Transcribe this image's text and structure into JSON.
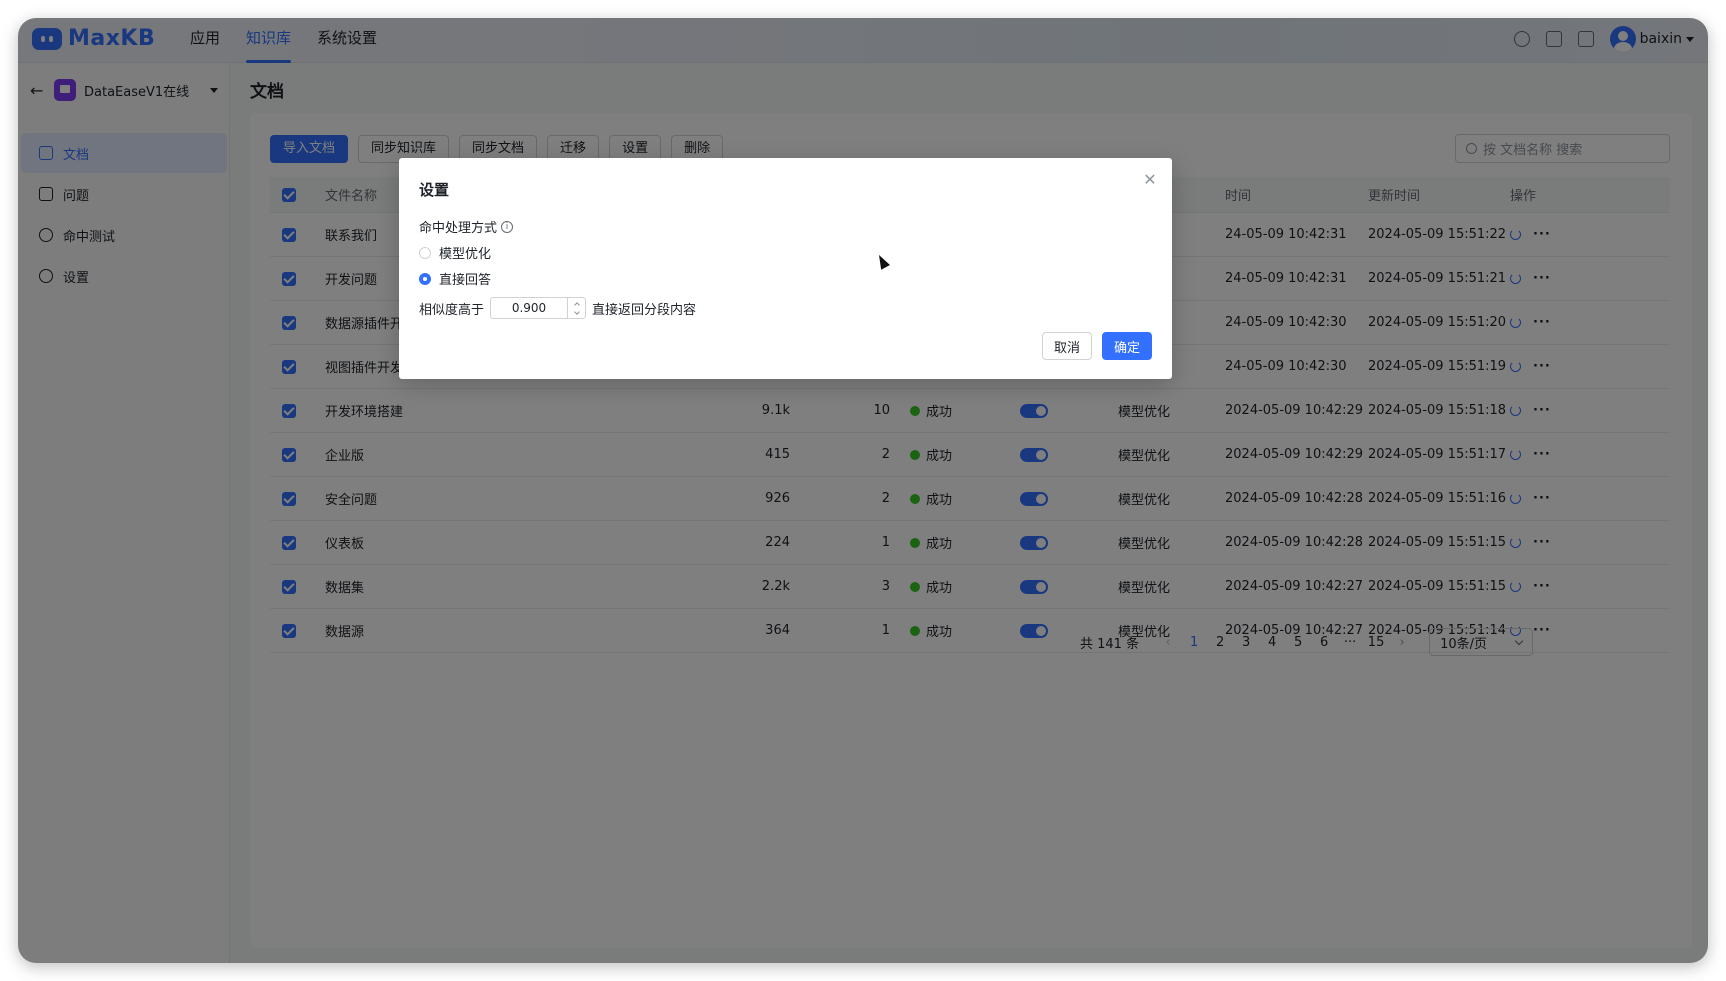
{
  "app": {
    "logo_text": "MaxKB"
  },
  "nav": {
    "items": [
      "应用",
      "知识库",
      "系统设置"
    ],
    "active": "知识库"
  },
  "user": {
    "name": "baixin"
  },
  "sidebar": {
    "dataset_name": "DataEaseV1在线",
    "items": [
      {
        "label": "文档",
        "icon": "document-icon",
        "active": true
      },
      {
        "label": "问题",
        "icon": "question-icon",
        "active": false
      },
      {
        "label": "命中测试",
        "icon": "target-icon",
        "active": false
      },
      {
        "label": "设置",
        "icon": "gear-icon",
        "active": false
      }
    ]
  },
  "page": {
    "title": "文档"
  },
  "toolbar": {
    "import_label": "导入文档",
    "sync_kb_label": "同步知识库",
    "sync_doc_label": "同步文档",
    "migrate_label": "迁移",
    "settings_label": "设置",
    "delete_label": "删除",
    "search_placeholder": "按 文档名称 搜索"
  },
  "table": {
    "headers": {
      "name": "文件名称",
      "created_partial": "时间",
      "updated": "更新时间",
      "ops": "操作"
    },
    "rows": [
      {
        "name": "联系我们",
        "chars": "",
        "segments": "",
        "status": "",
        "mode": "",
        "created": "24-05-09 10:42:31",
        "updated": "2024-05-09 15:51:22"
      },
      {
        "name": "开发问题",
        "chars": "",
        "segments": "",
        "status": "",
        "mode": "",
        "created": "24-05-09 10:42:31",
        "updated": "2024-05-09 15:51:21"
      },
      {
        "name": "数据源插件开发示例",
        "chars": "",
        "segments": "",
        "status": "",
        "mode": "",
        "created": "24-05-09 10:42:30",
        "updated": "2024-05-09 15:51:20"
      },
      {
        "name": "视图插件开发示例",
        "chars": "",
        "segments": "",
        "status": "",
        "mode": "",
        "created": "24-05-09 10:42:30",
        "updated": "2024-05-09 15:51:19"
      },
      {
        "name": "开发环境搭建",
        "chars": "9.1k",
        "segments": "10",
        "status": "成功",
        "mode": "模型优化",
        "created": "2024-05-09 10:42:29",
        "updated": "2024-05-09 15:51:18"
      },
      {
        "name": "企业版",
        "chars": "415",
        "segments": "2",
        "status": "成功",
        "mode": "模型优化",
        "created": "2024-05-09 10:42:29",
        "updated": "2024-05-09 15:51:17"
      },
      {
        "name": "安全问题",
        "chars": "926",
        "segments": "2",
        "status": "成功",
        "mode": "模型优化",
        "created": "2024-05-09 10:42:28",
        "updated": "2024-05-09 15:51:16"
      },
      {
        "name": "仪表板",
        "chars": "224",
        "segments": "1",
        "status": "成功",
        "mode": "模型优化",
        "created": "2024-05-09 10:42:28",
        "updated": "2024-05-09 15:51:15"
      },
      {
        "name": "数据集",
        "chars": "2.2k",
        "segments": "3",
        "status": "成功",
        "mode": "模型优化",
        "created": "2024-05-09 10:42:27",
        "updated": "2024-05-09 15:51:15"
      },
      {
        "name": "数据源",
        "chars": "364",
        "segments": "1",
        "status": "成功",
        "mode": "模型优化",
        "created": "2024-05-09 10:42:27",
        "updated": "2024-05-09 15:51:14"
      }
    ]
  },
  "pagination": {
    "total": "共 141 条",
    "pages": [
      "1",
      "2",
      "3",
      "4",
      "5",
      "6",
      "···",
      "15"
    ],
    "current": "1",
    "page_size": "10条/页"
  },
  "dialog": {
    "title": "设置",
    "field_label": "命中处理方式",
    "option_optimize": "模型优化",
    "option_direct": "直接回答",
    "selected": "直接回答",
    "threshold_prefix": "相似度高于",
    "threshold_value": "0.900",
    "threshold_suffix": "直接返回分段内容",
    "cancel_label": "取消",
    "confirm_label": "确定"
  },
  "colors": {
    "accent": "#3370ff",
    "success": "#34c724",
    "overlay": "rgba(0,0,0,0.5)"
  }
}
